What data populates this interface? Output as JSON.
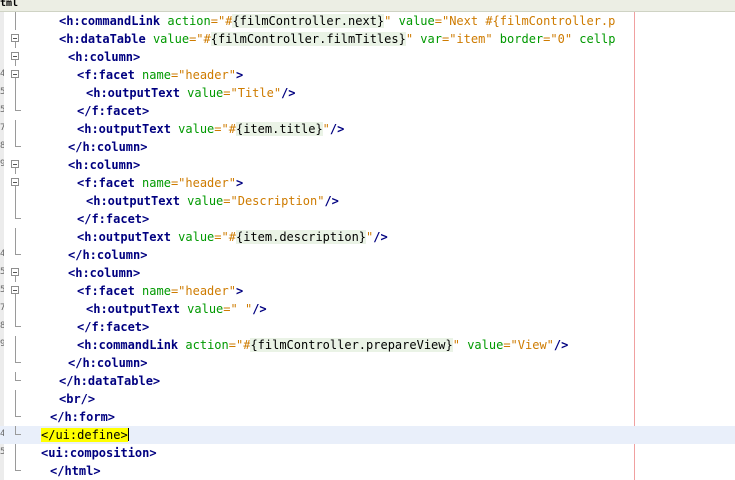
{
  "editor": {
    "tab_label": "tml",
    "lines": [
      {
        "indent": 7,
        "fold": "line",
        "num": "",
        "tokens": [
          [
            "t",
            "<h:commandLink"
          ],
          [
            "",
            "",
            " "
          ],
          [
            "a",
            "action"
          ],
          [
            "s",
            "=\"#"
          ],
          [
            "e",
            "{filmController.next}"
          ],
          [
            "s",
            "\""
          ],
          [
            "",
            "",
            " "
          ],
          [
            "a",
            "value"
          ],
          [
            "s",
            "=\"Next #{filmController.p"
          ]
        ]
      },
      {
        "indent": 7,
        "fold": "box",
        "num": "",
        "tokens": [
          [
            "t",
            "<h:dataTable"
          ],
          [
            "",
            "",
            " "
          ],
          [
            "a",
            "value"
          ],
          [
            "s",
            "=\"#"
          ],
          [
            "e",
            "{filmController.filmTitles}"
          ],
          [
            "s",
            "\""
          ],
          [
            "",
            "",
            " "
          ],
          [
            "a",
            "var"
          ],
          [
            "s",
            "=\"item\""
          ],
          [
            "",
            "",
            " "
          ],
          [
            "a",
            "border"
          ],
          [
            "s",
            "=\"0\""
          ],
          [
            "",
            "",
            " "
          ],
          [
            "a",
            "cellp"
          ]
        ]
      },
      {
        "indent": 9,
        "fold": "box",
        "num": "",
        "tokens": [
          [
            "t",
            "<h:column>"
          ]
        ]
      },
      {
        "indent": 11,
        "fold": "box",
        "num": "4",
        "tokens": [
          [
            "t",
            "<f:facet"
          ],
          [
            "",
            "",
            " "
          ],
          [
            "a",
            "name"
          ],
          [
            "s",
            "=\"header\""
          ],
          [
            "t",
            ">"
          ]
        ]
      },
      {
        "indent": 13,
        "fold": "line",
        "num": "5",
        "tokens": [
          [
            "t",
            "<h:outputText"
          ],
          [
            "",
            "",
            " "
          ],
          [
            "a",
            "value"
          ],
          [
            "s",
            "=\"Title\""
          ],
          [
            "t",
            "/>"
          ]
        ]
      },
      {
        "indent": 11,
        "fold": "corner",
        "num": "5",
        "tokens": [
          [
            "t",
            "</f:facet>"
          ]
        ]
      },
      {
        "indent": 11,
        "fold": "line",
        "num": "7",
        "tokens": [
          [
            "t",
            "<h:outputText"
          ],
          [
            "",
            "",
            " "
          ],
          [
            "a",
            "value"
          ],
          [
            "s",
            "=\"#"
          ],
          [
            "e",
            "{item.title}"
          ],
          [
            "s",
            "\""
          ],
          [
            "t",
            "/>"
          ]
        ]
      },
      {
        "indent": 9,
        "fold": "corner",
        "num": "8",
        "tokens": [
          [
            "t",
            "</h:column>"
          ]
        ]
      },
      {
        "indent": 9,
        "fold": "box",
        "num": "9",
        "tokens": [
          [
            "t",
            "<h:column>"
          ]
        ]
      },
      {
        "indent": 11,
        "fold": "box",
        "num": "",
        "tokens": [
          [
            "t",
            "<f:facet"
          ],
          [
            "",
            "",
            " "
          ],
          [
            "a",
            "name"
          ],
          [
            "s",
            "=\"header\""
          ],
          [
            "t",
            ">"
          ]
        ]
      },
      {
        "indent": 13,
        "fold": "line",
        "num": "",
        "tokens": [
          [
            "t",
            "<h:outputText"
          ],
          [
            "",
            "",
            " "
          ],
          [
            "a",
            "value"
          ],
          [
            "s",
            "=\"Description\""
          ],
          [
            "t",
            "/>"
          ]
        ]
      },
      {
        "indent": 11,
        "fold": "corner",
        "num": "",
        "tokens": [
          [
            "t",
            "</f:facet>"
          ]
        ]
      },
      {
        "indent": 11,
        "fold": "line",
        "num": "",
        "tokens": [
          [
            "t",
            "<h:outputText"
          ],
          [
            "",
            "",
            " "
          ],
          [
            "a",
            "value"
          ],
          [
            "s",
            "=\"#"
          ],
          [
            "e",
            "{item.description}"
          ],
          [
            "s",
            "\""
          ],
          [
            "t",
            "/>"
          ]
        ]
      },
      {
        "indent": 9,
        "fold": "corner",
        "num": "4",
        "tokens": [
          [
            "t",
            "</h:column>"
          ]
        ]
      },
      {
        "indent": 9,
        "fold": "box",
        "num": "5",
        "tokens": [
          [
            "t",
            "<h:column>"
          ]
        ]
      },
      {
        "indent": 11,
        "fold": "box",
        "num": "5",
        "tokens": [
          [
            "t",
            "<f:facet"
          ],
          [
            "",
            "",
            " "
          ],
          [
            "a",
            "name"
          ],
          [
            "s",
            "=\"header\""
          ],
          [
            "t",
            ">"
          ]
        ]
      },
      {
        "indent": 13,
        "fold": "line",
        "num": "7",
        "tokens": [
          [
            "t",
            "<h:outputText"
          ],
          [
            "",
            "",
            " "
          ],
          [
            "a",
            "value"
          ],
          [
            "s",
            "=\" \""
          ],
          [
            "t",
            "/>"
          ]
        ]
      },
      {
        "indent": 11,
        "fold": "corner",
        "num": "8",
        "tokens": [
          [
            "t",
            "</f:facet>"
          ]
        ]
      },
      {
        "indent": 11,
        "fold": "line",
        "num": "9",
        "tokens": [
          [
            "t",
            "<h:commandLink"
          ],
          [
            "",
            "",
            " "
          ],
          [
            "a",
            "action"
          ],
          [
            "s",
            "=\"#"
          ],
          [
            "e",
            "{filmController.prepareView}"
          ],
          [
            "s",
            "\""
          ],
          [
            "",
            "",
            " "
          ],
          [
            "a",
            "value"
          ],
          [
            "s",
            "=\"View\""
          ],
          [
            "t",
            "/>"
          ]
        ]
      },
      {
        "indent": 9,
        "fold": "corner",
        "num": "",
        "tokens": [
          [
            "t",
            "</h:column>"
          ]
        ]
      },
      {
        "indent": 7,
        "fold": "corner",
        "num": "",
        "tokens": [
          [
            "t",
            "</h:dataTable>"
          ]
        ]
      },
      {
        "indent": 7,
        "fold": "line",
        "num": "",
        "tokens": [
          [
            "t",
            "<br/>"
          ]
        ]
      },
      {
        "indent": 5,
        "fold": "corner",
        "num": "",
        "tokens": [
          [
            "t",
            "</h:form>"
          ]
        ]
      },
      {
        "indent": 3,
        "fold": "corner",
        "num": "4",
        "current": true,
        "tokens": [
          [
            "hl",
            "</ui:define>"
          ]
        ]
      },
      {
        "indent": 3,
        "fold": "line",
        "num": "5",
        "tokens": [
          [
            "t",
            "<ui:composition>"
          ]
        ]
      },
      {
        "indent": 5,
        "fold": "corner",
        "num": "",
        "tokens": [
          [
            "t",
            "</html>"
          ]
        ]
      }
    ]
  }
}
